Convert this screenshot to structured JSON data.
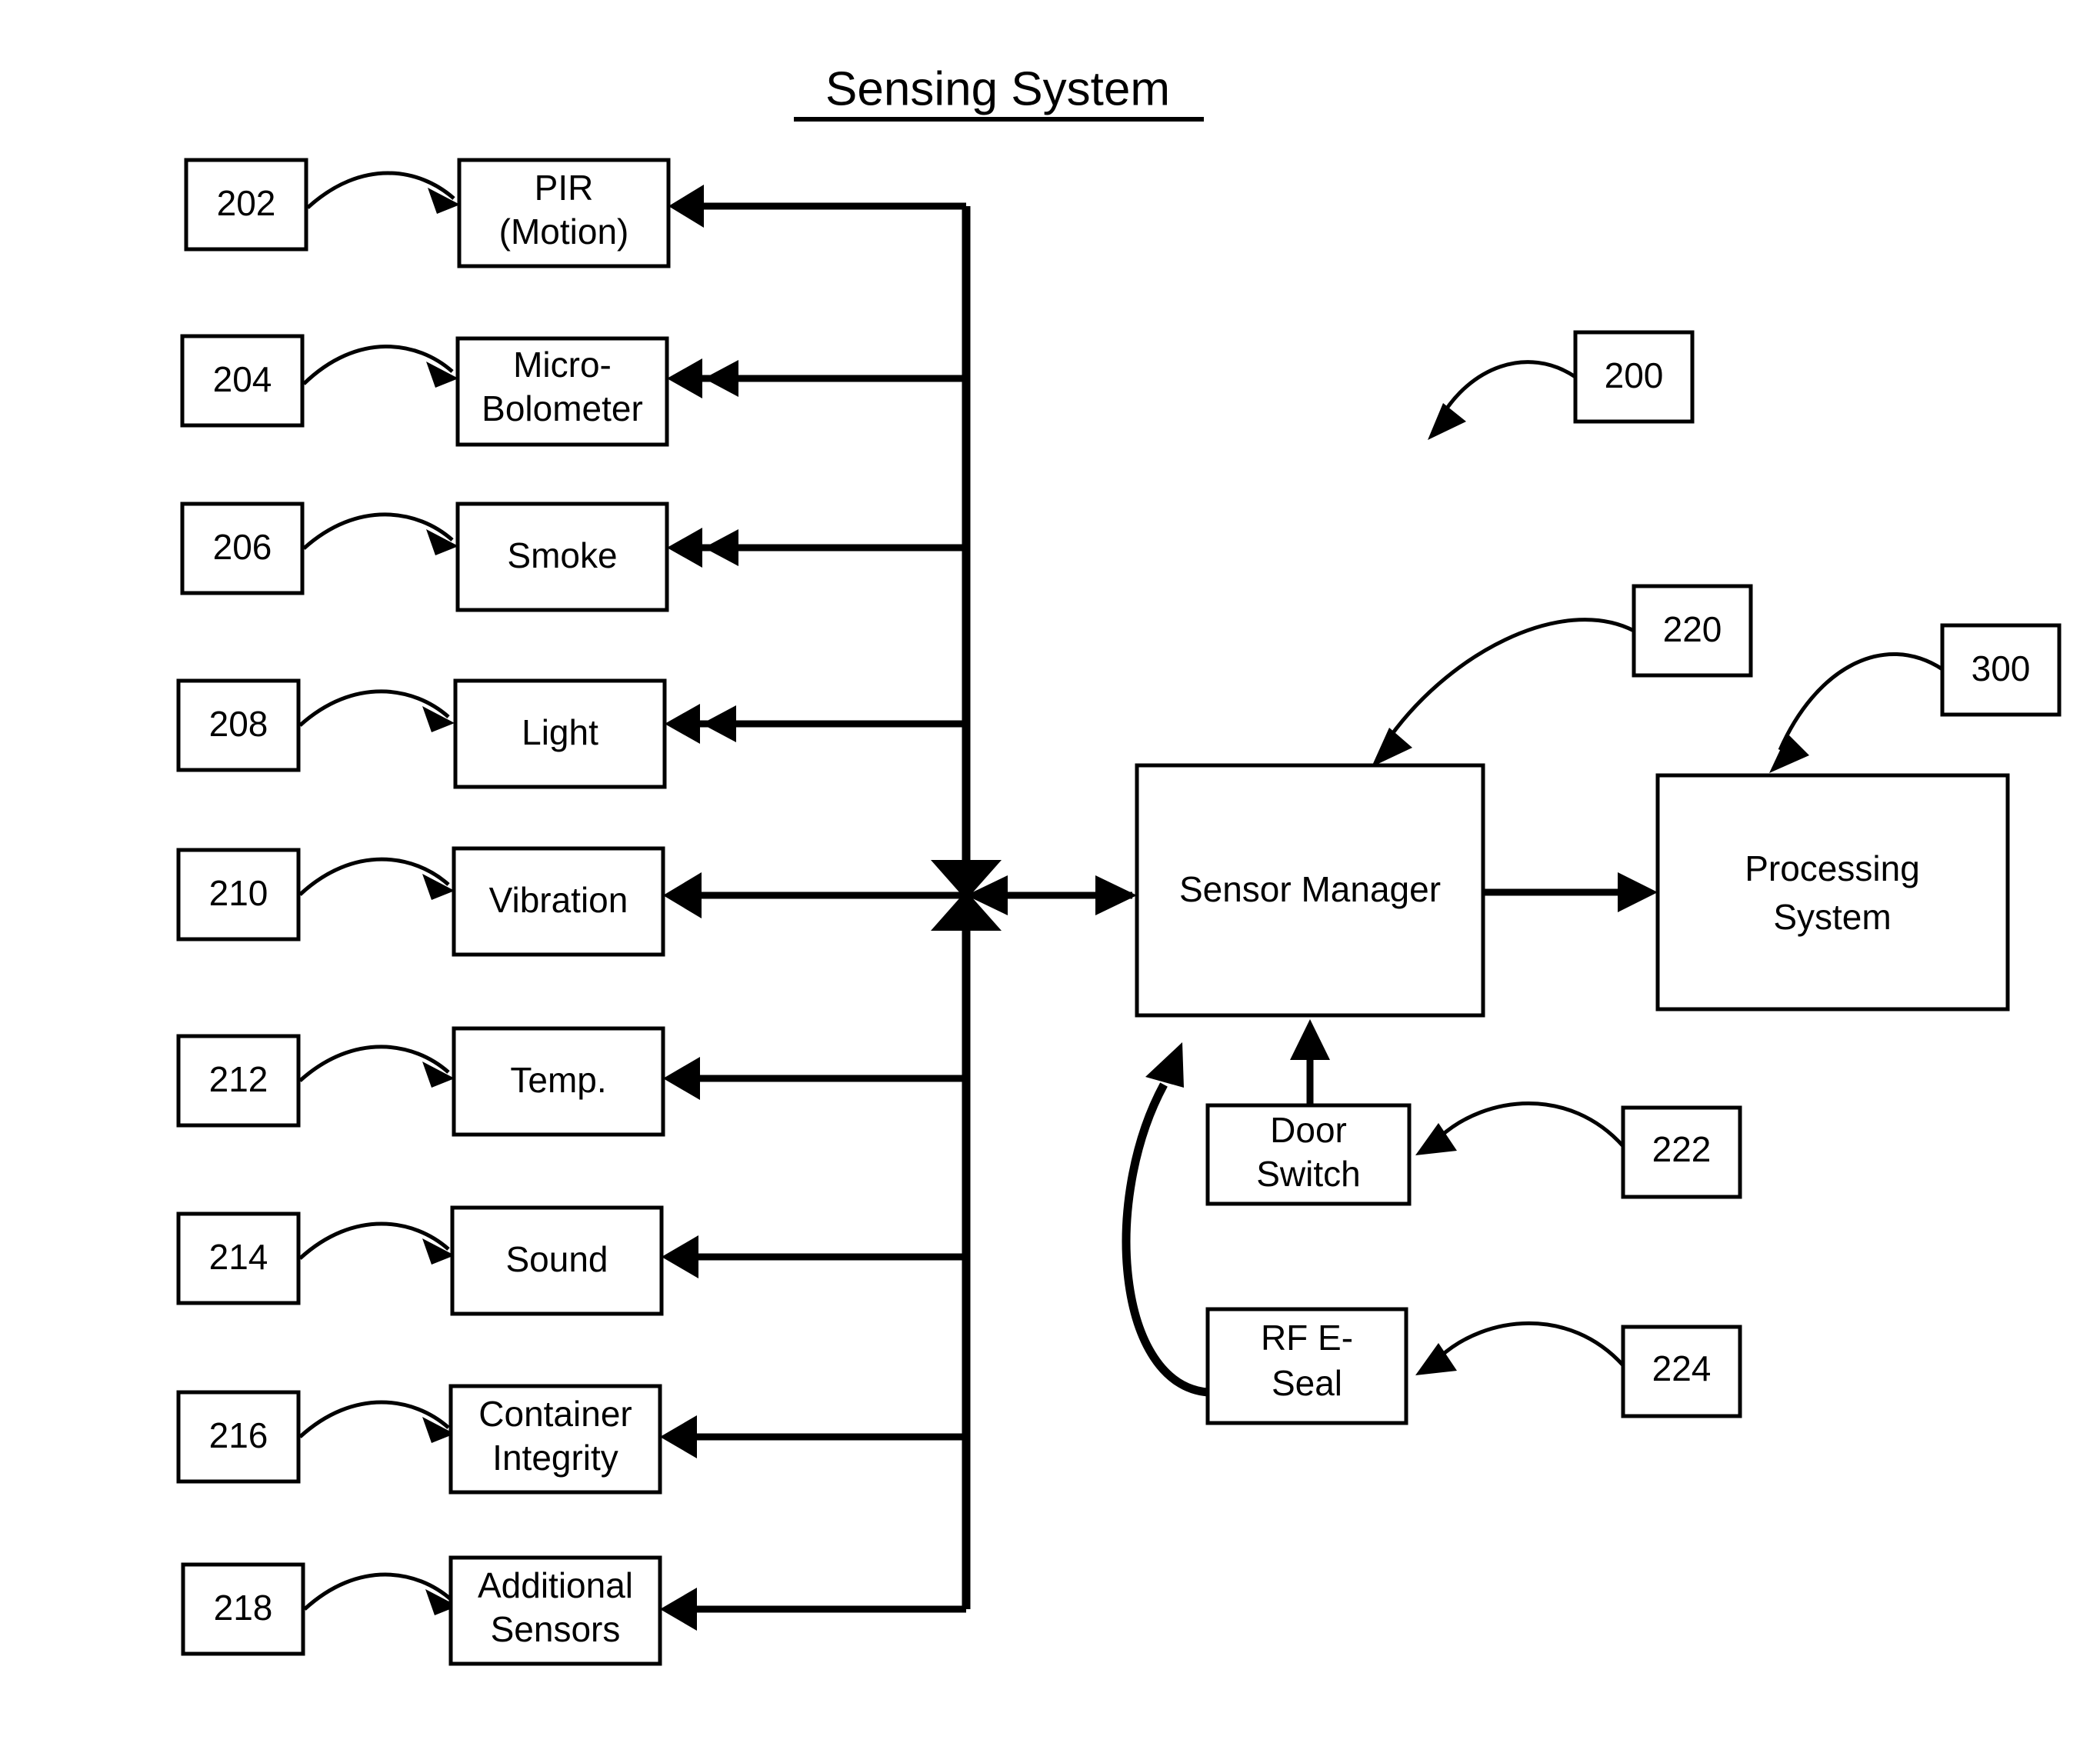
{
  "title": {
    "text": "Sensing System",
    "underlined": true
  },
  "sensors": [
    {
      "ref": "202",
      "label_line1": "PIR",
      "label_line2": "(Motion)"
    },
    {
      "ref": "204",
      "label_line1": "Micro-",
      "label_line2": "Bolometer"
    },
    {
      "ref": "206",
      "label_line1": "Smoke",
      "label_line2": ""
    },
    {
      "ref": "208",
      "label_line1": "Light",
      "label_line2": ""
    },
    {
      "ref": "210",
      "label_line1": "Vibration",
      "label_line2": ""
    },
    {
      "ref": "212",
      "label_line1": "Temp.",
      "label_line2": ""
    },
    {
      "ref": "214",
      "label_line1": "Sound",
      "label_line2": ""
    },
    {
      "ref": "216",
      "label_line1": "Container",
      "label_line2": "Integrity"
    },
    {
      "ref": "218",
      "label_line1": "Additional",
      "label_line2": "Sensors"
    }
  ],
  "blocks": {
    "sensor_manager": {
      "label_line1": "Sensor Manager",
      "label_line2": ""
    },
    "processing_system": {
      "label_line1": "Processing",
      "label_line2": "System"
    },
    "door_switch": {
      "label_line1": "Door",
      "label_line2": "Switch"
    },
    "rf_e_seal": {
      "label_line1": "RF E-",
      "label_line2": "Seal"
    }
  },
  "reference_labels": {
    "system": "200",
    "sensor_manager": "220",
    "processing_system": "300",
    "door_switch": "222",
    "rf_e_seal": "224"
  },
  "colors": {
    "stroke": "#000000",
    "fill": "#ffffff",
    "background": "#ffffff"
  }
}
